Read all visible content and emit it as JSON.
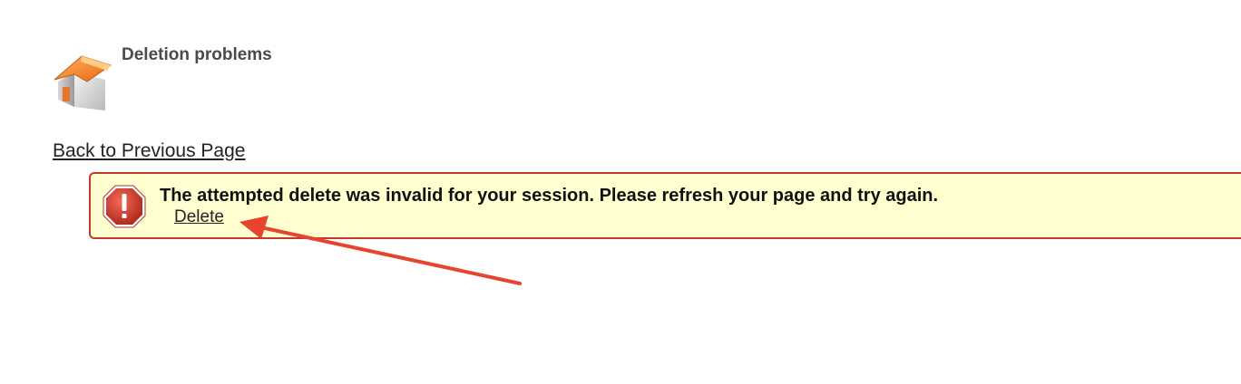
{
  "header": {
    "title": "Deletion problems",
    "icon": "home-icon"
  },
  "navigation": {
    "back_link": "Back to Previous Page"
  },
  "error": {
    "icon": "stop-icon",
    "message": "The attempted delete was invalid for your session. Please refresh your page and try again.",
    "action_link": "Delete",
    "border_color": "#c0392b",
    "background_color": "#ffffd0"
  },
  "annotation": {
    "type": "arrow",
    "color": "#e8432e",
    "points_to": "delete-link"
  }
}
